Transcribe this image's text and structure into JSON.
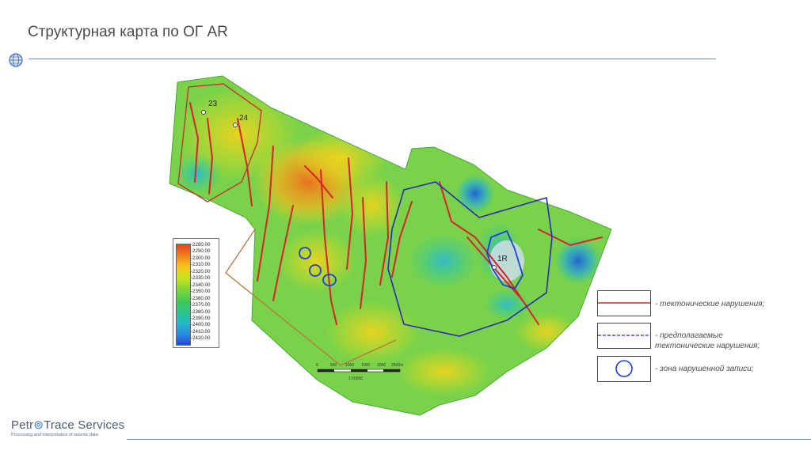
{
  "header": {
    "title": "Структурная карта по ОГ AR"
  },
  "map": {
    "well_labels": [
      "23",
      "24",
      "1R"
    ]
  },
  "depth_scale": {
    "values": [
      "-2280.00",
      "-2290.00",
      "-2300.00",
      "-2310.00",
      "-2320.00",
      "-2330.00",
      "-2340.00",
      "-2350.00",
      "-2360.00",
      "-2370.00",
      "-2380.00",
      "-2390.00",
      "-2400.00",
      "-2410.00",
      "-2420.00"
    ]
  },
  "scale_bar": {
    "ticks": [
      "0",
      "500",
      "1000",
      "1500",
      "2000",
      "2500m"
    ],
    "ratio": "1:50000"
  },
  "legend": {
    "items": [
      {
        "label": "- тектонические нарушения;"
      },
      {
        "label_line1": "- предполагаемые",
        "label_line2": "тектонические нарушения;"
      },
      {
        "label": "- зона нарушенной записи;"
      }
    ]
  },
  "footer": {
    "logo_name_a": "Petr",
    "logo_name_b": "Trace Services",
    "logo_tagline": "Processing and interpretation of seismic data"
  },
  "colors": {
    "fault": "#d8232a",
    "assumed_fault": "#2b2bb0",
    "disturbed_zone": "#1f3fd8",
    "rule": "#6a8fbf"
  }
}
